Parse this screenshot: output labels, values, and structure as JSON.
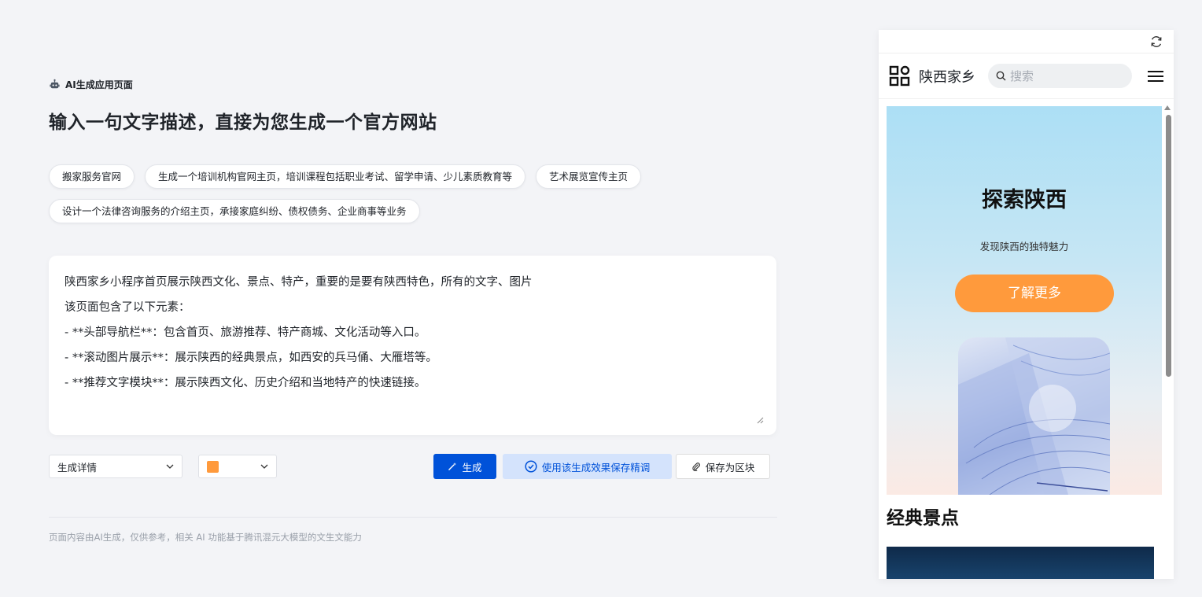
{
  "header": {
    "tag": "AI生成应用页面",
    "title": "输入一句文字描述，直接为您生成一个官方网站"
  },
  "chips": [
    "搬家服务官网",
    "生成一个培训机构官网主页，培训课程包括职业考试、留学申请、少儿素质教育等",
    "艺术展览宣传主页",
    "设计一个法律咨询服务的介绍主页，承接家庭纠纷、债权债务、企业商事等业务"
  ],
  "prompt": {
    "lines": [
      "陕西家乡小程序首页展示陕西文化、景点、特产，重要的是要有陕西特色，所有的文字、图片",
      "该页面包含了以下元素：",
      "- **头部导航栏**：包含首页、旅游推荐、特产商城、文化活动等入口。",
      "- **滚动图片展示**：展示陕西的经典景点，如西安的兵马俑、大雁塔等。",
      "- **推荐文字模块**：展示陕西文化、历史介绍和当地特产的快速链接。"
    ]
  },
  "controls": {
    "detail_select": "生成详情",
    "color_swatch": "#ff9a3c",
    "generate_label": "生成",
    "save_fine_label": "使用该生成效果保存精调",
    "save_block_label": "保存为区块"
  },
  "footnote": "页面内容由AI生成，仅供参考，相关 AI 功能基于腾讯混元大模型的文生文能力",
  "preview": {
    "site_name": "陕西家乡",
    "search_placeholder": "搜索",
    "hero_title": "探索陕西",
    "hero_subtitle": "发现陕西的独特魅力",
    "hero_button": "了解更多",
    "section_title": "经典景点"
  },
  "colors": {
    "primary": "#0052d9",
    "accent": "#ff9a3c",
    "background": "#f3f4f7"
  }
}
